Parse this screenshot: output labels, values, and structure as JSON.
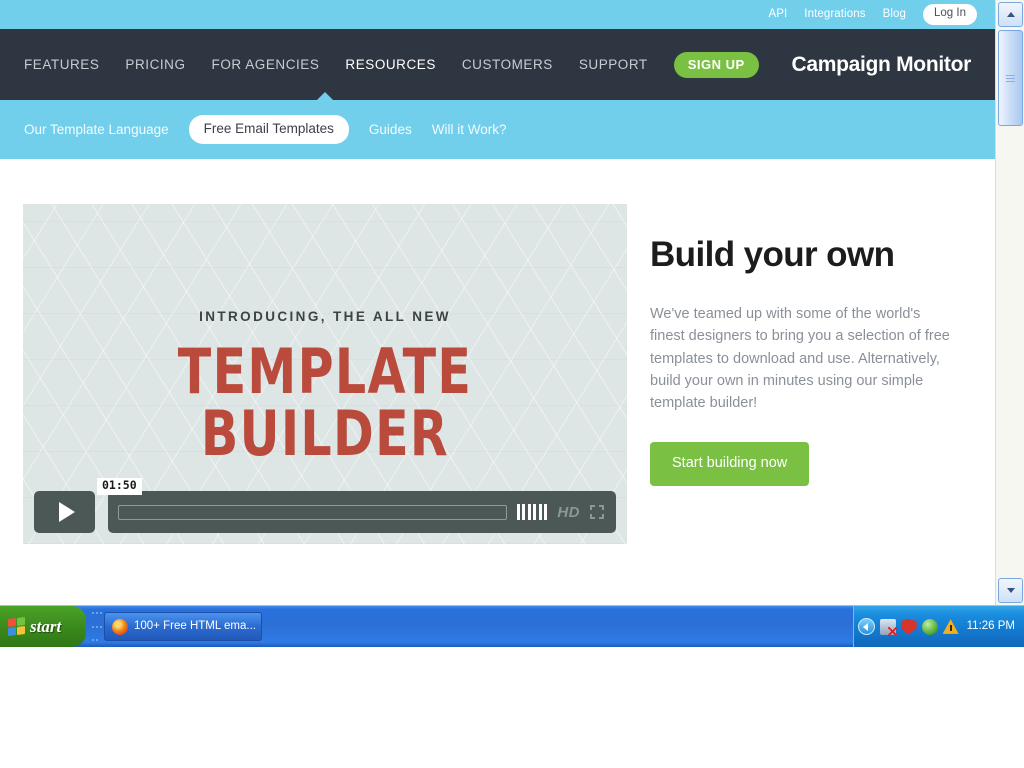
{
  "utility_bar": {
    "links": [
      {
        "label": "API"
      },
      {
        "label": "Integrations"
      },
      {
        "label": "Blog"
      }
    ],
    "login_label": "Log In"
  },
  "main_nav": {
    "items": [
      {
        "label": "FEATURES",
        "active": false
      },
      {
        "label": "PRICING",
        "active": false
      },
      {
        "label": "FOR AGENCIES",
        "active": false
      },
      {
        "label": "RESOURCES",
        "active": true
      },
      {
        "label": "CUSTOMERS",
        "active": false
      },
      {
        "label": "SUPPORT",
        "active": false
      }
    ],
    "signup_label": "SIGN UP",
    "brand": "Campaign Monitor"
  },
  "sub_nav": {
    "items": [
      {
        "label": "Our Template Language",
        "selected": false
      },
      {
        "label": "Free Email Templates",
        "selected": true
      },
      {
        "label": "Guides",
        "selected": false
      },
      {
        "label": "Will it Work?",
        "selected": false
      }
    ]
  },
  "video": {
    "kicker": "INTRODUCING, THE ALL NEW",
    "headline": "TEMPLATE BUILDER",
    "time_tooltip": "01:50",
    "hd_label": "HD",
    "volume_bars": 6
  },
  "main": {
    "headline": "Build your own",
    "body": "We've teamed up with some of the world's finest designers to bring you a selection of free templates to download and use. Alternatively, build your own in minutes using our simple template builder!",
    "cta_label": "Start building now"
  },
  "taskbar": {
    "start_label": "start",
    "task_button_label": "100+ Free HTML ema...",
    "clock": "11:26 PM"
  },
  "colors": {
    "sky": "#72cfec",
    "nav_dark": "#2e3641",
    "green": "#7ac143",
    "video_bg": "#dde5e5",
    "headline_red": "#b94a3c",
    "body_text": "#8a9099"
  }
}
